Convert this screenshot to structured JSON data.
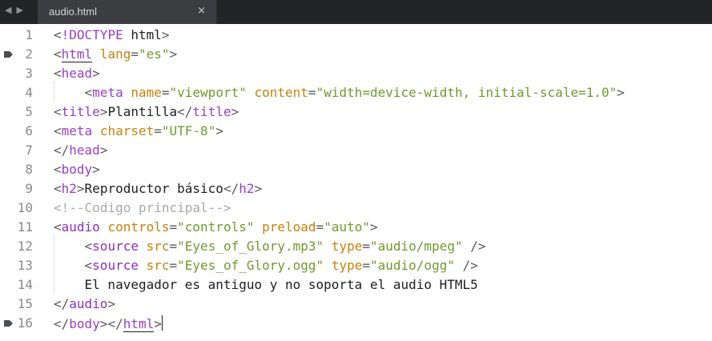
{
  "tabbar": {
    "back_icon": "chevron-left-icon",
    "forward_icon": "chevron-right-icon",
    "tab_title": "audio.html",
    "close_glyph": "×"
  },
  "editor": {
    "lines": [
      {
        "n": "1"
      },
      {
        "n": "2"
      },
      {
        "n": "3"
      },
      {
        "n": "4"
      },
      {
        "n": "5"
      },
      {
        "n": "6"
      },
      {
        "n": "7"
      },
      {
        "n": "8"
      },
      {
        "n": "9"
      },
      {
        "n": "10"
      },
      {
        "n": "11"
      },
      {
        "n": "12"
      },
      {
        "n": "13"
      },
      {
        "n": "14"
      },
      {
        "n": "15"
      },
      {
        "n": "16"
      }
    ],
    "tokens": {
      "l1": [
        "<",
        "!DOCTYPE",
        " html",
        ">"
      ],
      "l2": [
        "<",
        "html",
        " ",
        "lang",
        "=",
        "\"es\"",
        ">"
      ],
      "l3": [
        "<",
        "head",
        ">"
      ],
      "l4": [
        "    <",
        "meta",
        " ",
        "name",
        "=",
        "\"viewport\"",
        " ",
        "content",
        "=",
        "\"width=device-width, initial-scale=1.0\"",
        ">"
      ],
      "l5": [
        "<",
        "title",
        ">",
        "Plantilla",
        "</",
        "title",
        ">"
      ],
      "l6": [
        "<",
        "meta",
        " ",
        "charset",
        "=",
        "\"UTF-8\"",
        ">"
      ],
      "l7": [
        "</",
        "head",
        ">"
      ],
      "l8": [
        "<",
        "body",
        ">"
      ],
      "l9": [
        "<",
        "h2",
        ">",
        "Reproductor básico",
        "</",
        "h2",
        ">"
      ],
      "l10": [
        "<!--Codigo principal-->"
      ],
      "l11": [
        "<",
        "audio",
        " ",
        "controls",
        "=",
        "\"controls\"",
        " ",
        "preload",
        "=",
        "\"auto\"",
        ">"
      ],
      "l12": [
        "    <",
        "source",
        " ",
        "src",
        "=",
        "\"Eyes_of_Glory.mp3\"",
        " ",
        "type",
        "=",
        "\"audio/mpeg\"",
        " />"
      ],
      "l13": [
        "    <",
        "source",
        " ",
        "src",
        "=",
        "\"Eyes_of_Glory.ogg\"",
        " ",
        "type",
        "=",
        "\"audio/ogg\"",
        " />"
      ],
      "l14": [
        "    El navegador es antiguo y no soporta el audio HTML5"
      ],
      "l15": [
        "</",
        "audio",
        ">"
      ],
      "l16": [
        "</",
        "body",
        ">",
        "</",
        "html",
        ">"
      ]
    },
    "bookmark_lines": [
      "2",
      "16"
    ]
  },
  "colors": {
    "tag": "#9b3ec2",
    "attribute": "#c5820d",
    "string": "#6f9a2e",
    "comment": "#a8a8a8",
    "background": "#ffffff",
    "tabbar": "#222426"
  }
}
